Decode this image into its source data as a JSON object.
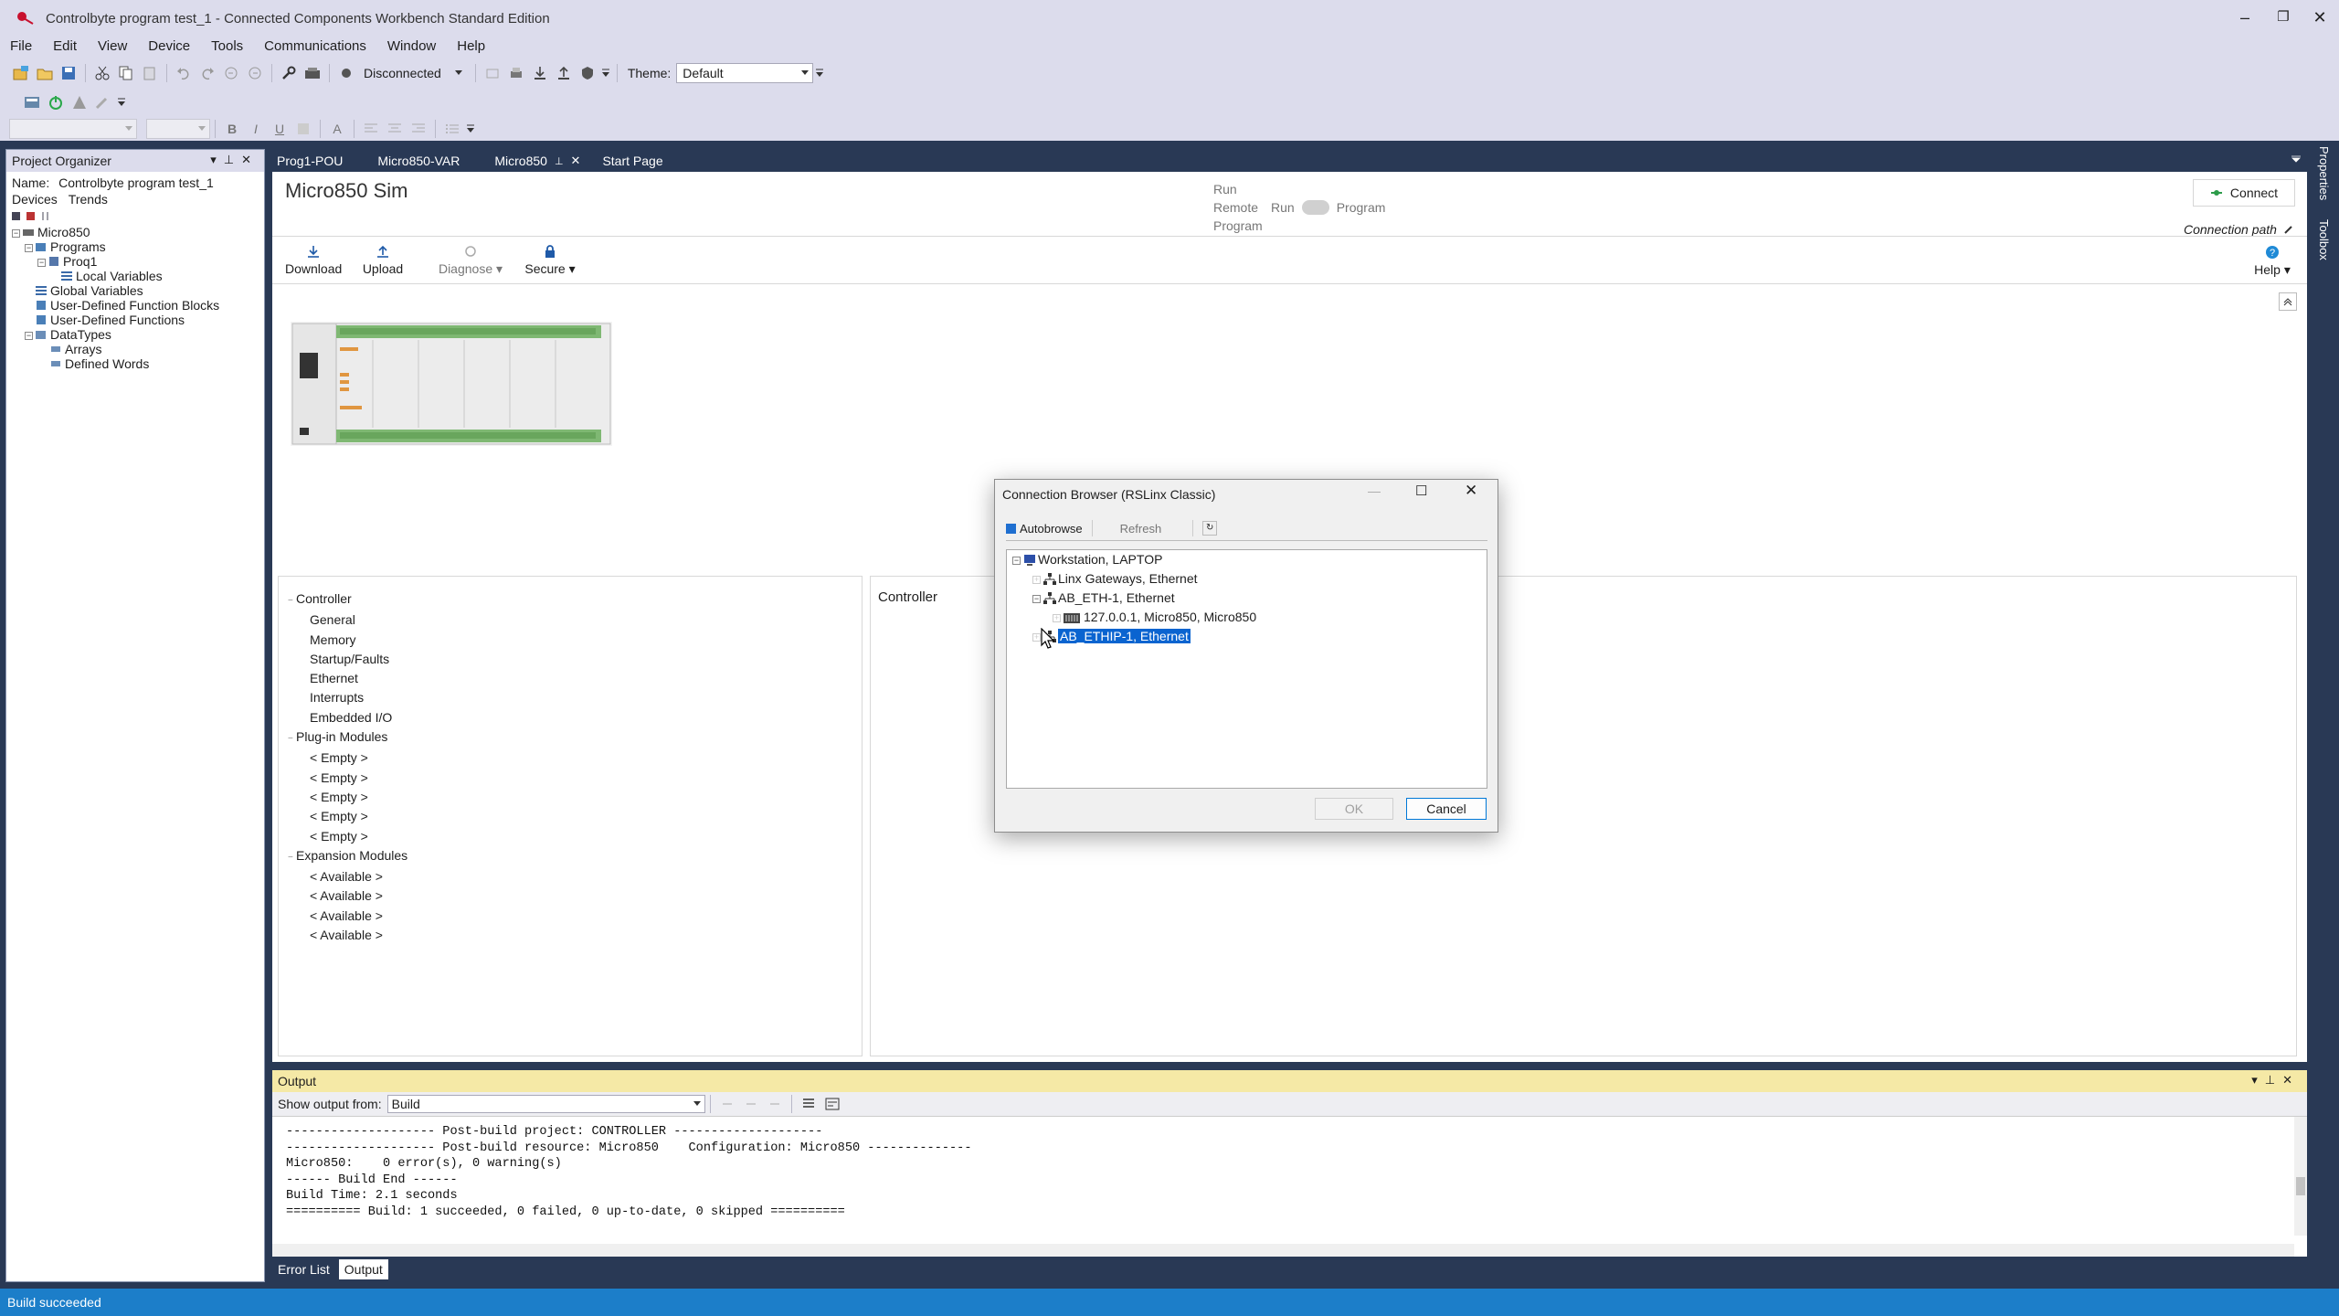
{
  "window": {
    "title": "Controlbyte program test_1 - Connected Components Workbench Standard Edition",
    "minimize": "–",
    "restore": "❐",
    "close": "✕"
  },
  "menu": [
    "File",
    "Edit",
    "View",
    "Device",
    "Tools",
    "Communications",
    "Window",
    "Help"
  ],
  "toolbar": {
    "connection_status": "Disconnected",
    "theme_label": "Theme:",
    "theme_value": "Default"
  },
  "project_organizer": {
    "title": "Project Organizer",
    "name_label": "Name:",
    "name_value": "Controlbyte program test_1",
    "tabs": [
      "Devices",
      "Trends"
    ],
    "tree": {
      "root": "Micro850",
      "programs": "Programs",
      "prog1": "Proq1",
      "local_vars": "Local Variables",
      "global_vars": "Global Variables",
      "udfb": "User-Defined Function Blocks",
      "udf": "User-Defined Functions",
      "datatypes": "DataTypes",
      "arrays": "Arrays",
      "defined_words": "Defined Words"
    }
  },
  "doc_tabs": [
    "Prog1-POU",
    "Micro850-VAR",
    "Micro850",
    "Start Page"
  ],
  "controller_page": {
    "title": "Micro850 Sim",
    "mode_labels": {
      "run": "Run",
      "remote": "Remote",
      "program_small": "Program",
      "run_toggle": "Run",
      "program_toggle": "Program"
    },
    "connect_button": "Connect",
    "connection_path": "Connection path",
    "actions": [
      "Download",
      "Upload",
      "Diagnose",
      "Secure"
    ],
    "help": "Help",
    "device_tree": {
      "controller": "Controller",
      "controller_children": [
        "General",
        "Memory",
        "Startup/Faults",
        "Ethernet",
        "Interrupts",
        "Embedded I/O"
      ],
      "plugin": "Plug-in Modules",
      "plugin_children": [
        "< Empty >",
        "< Empty >",
        "< Empty >",
        "< Empty >",
        "< Empty >"
      ],
      "expansion": "Expansion Modules",
      "expansion_children": [
        "< Available >",
        "< Available >",
        "< Available >",
        "< Available >"
      ]
    },
    "detail_title": "Controller"
  },
  "dialog": {
    "title": "Connection Browser (RSLinx Classic)",
    "autobrowse": "Autobrowse",
    "refresh": "Refresh",
    "tree": {
      "workstation": "Workstation, LAPTOP",
      "linx_gateways": "Linx Gateways, Ethernet",
      "ab_eth": "AB_ETH-1, Ethernet",
      "device": "127.0.0.1, Micro850, Micro850",
      "ab_ethip": "AB_ETHIP-1, Ethernet"
    },
    "ok": "OK",
    "cancel": "Cancel"
  },
  "output": {
    "title": "Output",
    "show_from_label": "Show output from:",
    "show_from_value": "Build",
    "lines": [
      "-------------------- Post-build project: CONTROLLER --------------------",
      "-------------------- Post-build resource: Micro850    Configuration: Micro850 --------------",
      "Micro850:    0 error(s), 0 warning(s)",
      "------ Build End ------",
      "Build Time: 2.1 seconds",
      "========== Build: 1 succeeded, 0 failed, 0 up-to-date, 0 skipped =========="
    ]
  },
  "bottom_tabs": [
    "Error List",
    "Output"
  ],
  "status": "Build succeeded",
  "right_tabs": [
    "Properties",
    "Toolbox"
  ]
}
